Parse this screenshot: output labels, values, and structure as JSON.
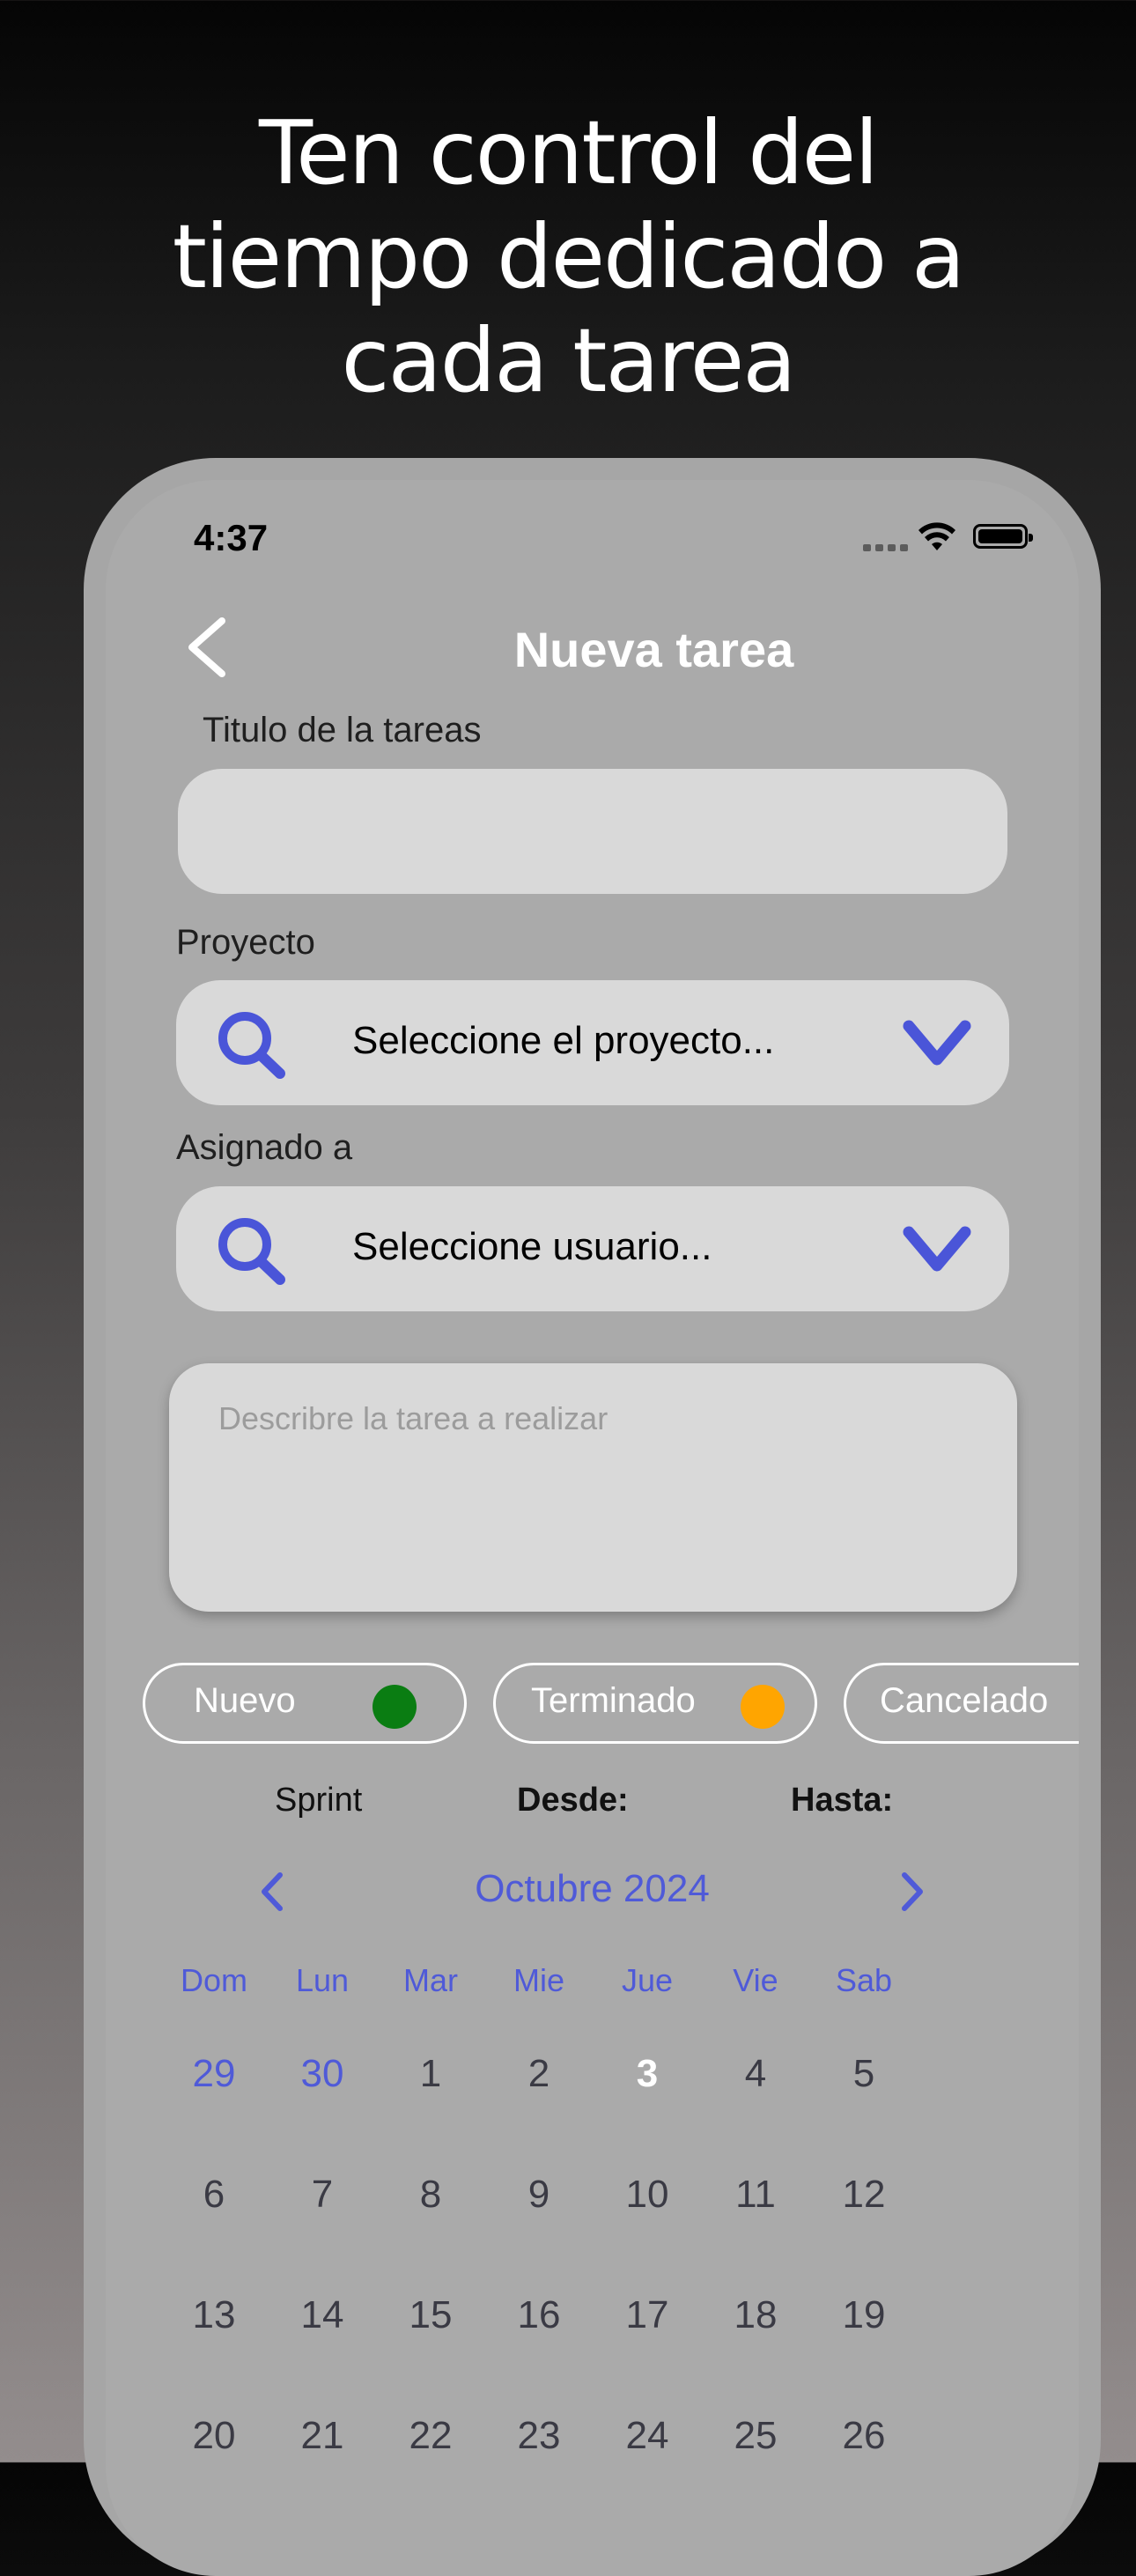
{
  "headline": [
    "Ten control del",
    "tiempo dedicado a",
    "cada tarea"
  ],
  "status_bar": {
    "time": "4:37"
  },
  "nav": {
    "title": "Nueva tarea"
  },
  "form": {
    "title_label": "Titulo de la tareas",
    "title_value": "",
    "project_label": "Proyecto",
    "project_placeholder": "Seleccione el proyecto...",
    "assigned_label": "Asignado a",
    "assigned_placeholder": "Seleccione usuario...",
    "description_placeholder": "Describre la tarea a realizar"
  },
  "status_chips": [
    {
      "label": "Nuevo",
      "color": "#0a7d12"
    },
    {
      "label": "Terminado",
      "color": "#ffa500"
    },
    {
      "label": "Cancelado"
    }
  ],
  "period": {
    "sprint": "Sprint",
    "from": "Desde:",
    "to": "Hasta:"
  },
  "calendar": {
    "month": "Octubre 2024",
    "weekdays": [
      "Dom",
      "Lun",
      "Mar",
      "Mie",
      "Jue",
      "Vie",
      "Sab"
    ],
    "weeks": [
      [
        "29",
        "30",
        "1",
        "2",
        "3",
        "4",
        "5"
      ],
      [
        "6",
        "7",
        "8",
        "9",
        "10",
        "11",
        "12"
      ],
      [
        "13",
        "14",
        "15",
        "16",
        "17",
        "18",
        "19"
      ],
      [
        "20",
        "21",
        "22",
        "23",
        "24",
        "25",
        "26"
      ]
    ],
    "today": "3"
  },
  "colors": {
    "accent": "#4f5ad8",
    "field": "#d9d9d9",
    "screen": "#aaaaaa"
  }
}
